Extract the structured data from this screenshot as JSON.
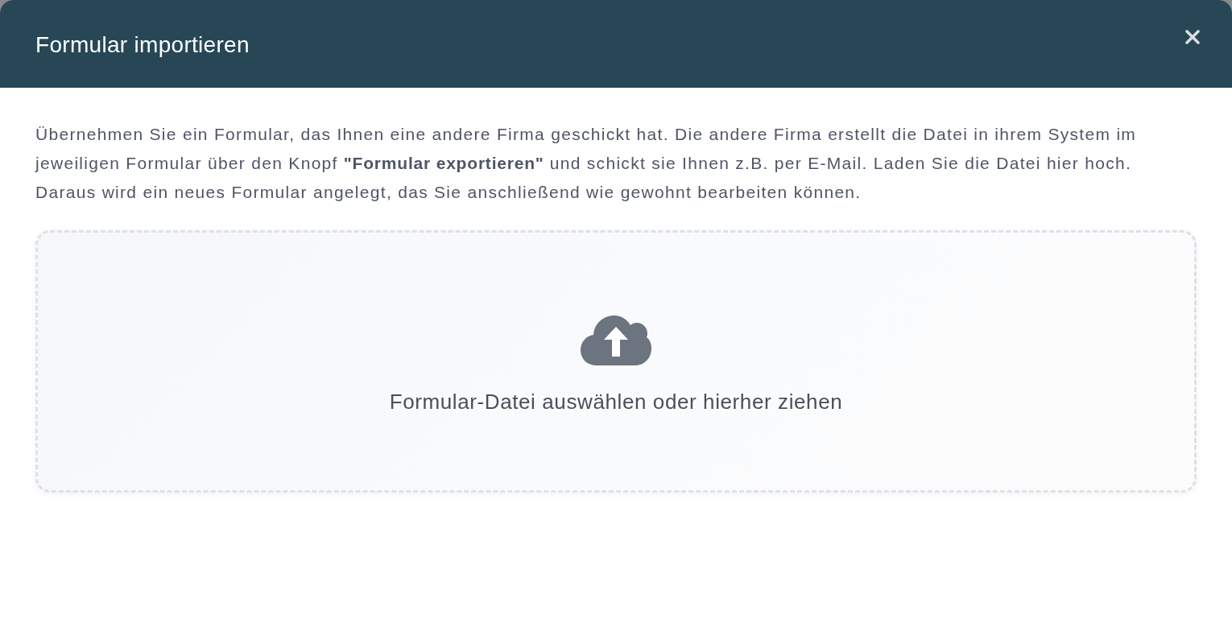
{
  "dialog": {
    "title": "Formular importieren"
  },
  "description": "Übernehmen Sie ein Formular, das Ihnen eine andere Firma geschickt hat. Die andere Firma erstellt die Datei in ihrem System im jeweiligen Formular über den Knopf **\"Formular exportieren\"** und schickt sie Ihnen z.B. per E-Mail. Laden Sie die Datei hier hoch. Daraus wird ein neues Formular angelegt, das Sie anschließend wie gewohnt bearbeiten können.",
  "dropzone": {
    "label": "Formular-Datei auswählen oder hierher ziehen"
  }
}
